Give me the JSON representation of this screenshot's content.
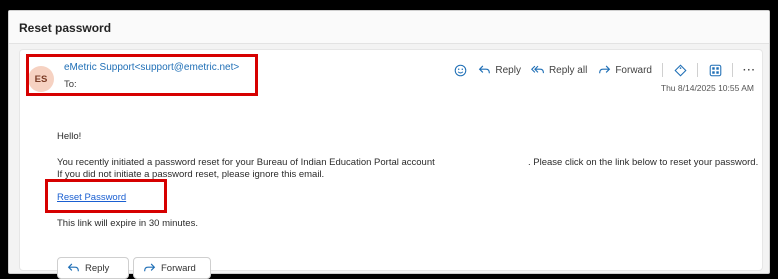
{
  "email": {
    "subject": "Reset password",
    "avatar_initials": "ES",
    "sender": "eMetric Support<support@emetric.net>",
    "to_label": "To:",
    "date": "Thu 8/14/2025 10:55 AM",
    "greeting": "Hello!",
    "line1_part1": "You recently initiated a password reset for your Bureau of Indian Education Portal account",
    "line1_part2": ". Please click on the link below to reset your password.",
    "line2": "If you did not initiate a password reset, please ignore this email.",
    "link_text": "Reset Password",
    "expiry": "This link will expire in 30 minutes."
  },
  "toolbar": {
    "reply": "Reply",
    "reply_all": "Reply all",
    "forward": "Forward",
    "more": "···"
  },
  "footer": {
    "reply": "Reply",
    "forward": "Forward"
  },
  "colors": {
    "accent": "#1f6fb6",
    "highlight": "#d60000",
    "avatar_bg": "#f6d2c2"
  }
}
